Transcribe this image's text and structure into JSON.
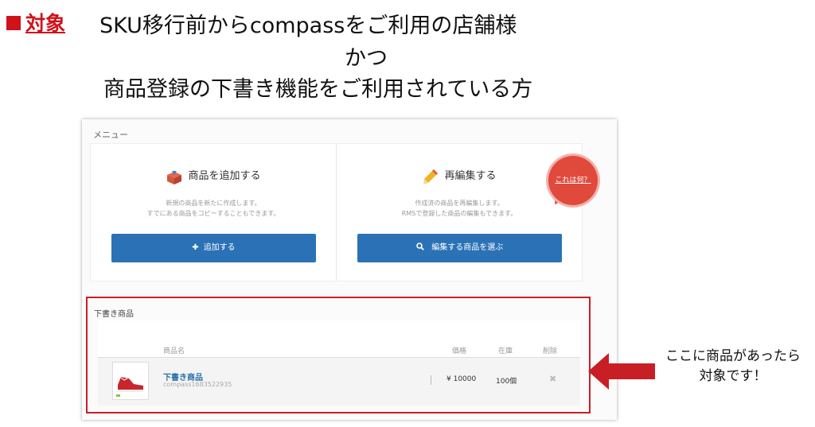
{
  "header": {
    "target_label": "対象",
    "line1": "SKU移行前からcompassをご利用の店舗様",
    "line2": "かつ",
    "line3": "商品登録の下書き機能をご利用されている方"
  },
  "menu": {
    "label": "メニュー",
    "add": {
      "title": "商品を追加する",
      "desc1": "新規の商品を新たに作成します。",
      "desc2": "すでにある商品をコピーすることもできます。",
      "button": "追加する",
      "button_icon": "plus-icon"
    },
    "edit": {
      "title": "再編集する",
      "desc1": "作成済の商品を再編集します。",
      "desc2": "RMSで登録した商品の編集もできます。",
      "button": "編集する商品を選ぶ",
      "button_icon": "search-icon"
    },
    "help_bubble": "これは何？"
  },
  "drafts": {
    "label": "下書き商品",
    "columns": [
      "商品名",
      "価格",
      "在庫",
      "削除"
    ],
    "rows": [
      {
        "name": "下書き商品",
        "code": "compass1683522935",
        "price": "¥ 10000",
        "stock": "100個",
        "delete": "✖"
      }
    ]
  },
  "callout": {
    "line1": "ここに商品があったら",
    "line2": "対象です！"
  },
  "colors": {
    "accent_red": "#d0121b",
    "button_blue": "#2a72b5",
    "bubble_red": "#e04a3c",
    "highlight_border": "#c81f26"
  }
}
